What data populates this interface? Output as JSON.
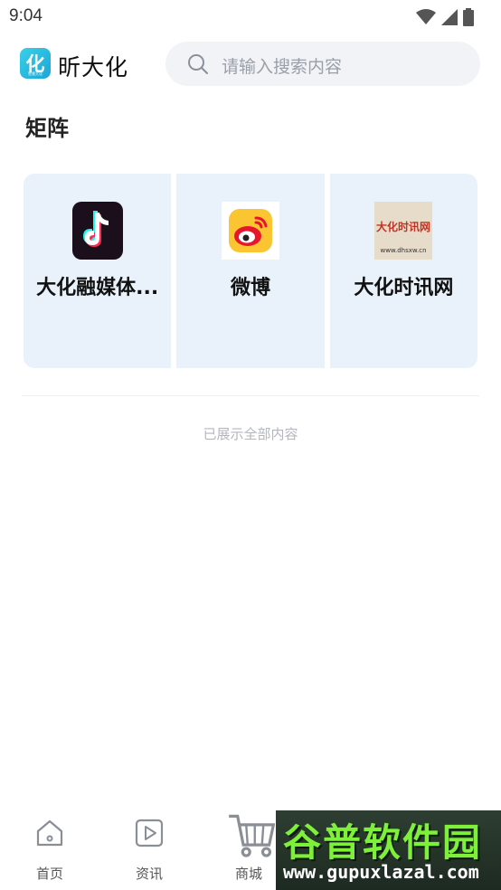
{
  "status_bar": {
    "time": "9:04",
    "icons": [
      "wifi-icon",
      "signal-icon",
      "battery-icon"
    ]
  },
  "header": {
    "logo_glyph": "化",
    "logo_caption": "智慧大化",
    "app_name": "昕大化",
    "search_placeholder": "请输入搜索内容"
  },
  "section": {
    "title": "矩阵"
  },
  "cards": [
    {
      "label": "大化融媒体...",
      "icon": "douyin-icon"
    },
    {
      "label": "微博",
      "icon": "weibo-icon"
    },
    {
      "label": "大化时讯网",
      "icon": "dhsxw-logo",
      "logo_text": "大化时讯网",
      "logo_url": "www.dhsxw.cn"
    }
  ],
  "footer_note": "已展示全部内容",
  "tabs": [
    {
      "label": "首页",
      "icon": "home-icon"
    },
    {
      "label": "资讯",
      "icon": "play-icon"
    },
    {
      "label": "商城",
      "icon": "cart-icon"
    }
  ],
  "watermark": {
    "title": "谷普软件园",
    "url": "www.gupuxlazal.com"
  },
  "colors": {
    "card_bg": "#e9f2fb",
    "search_bg": "#f1f3f7",
    "brand": "#1aa6d6"
  }
}
